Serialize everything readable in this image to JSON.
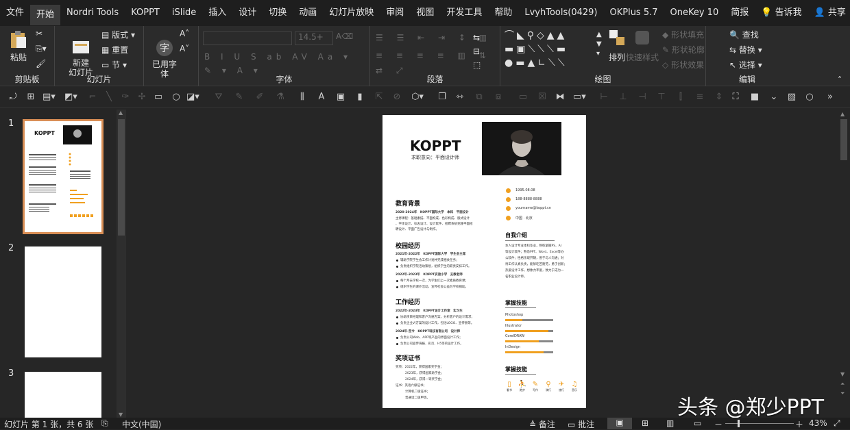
{
  "menu": {
    "tabs": [
      "文件",
      "开始",
      "Nordri Tools",
      "KOPPT",
      "iSlide",
      "插入",
      "设计",
      "切换",
      "动画",
      "幻灯片放映",
      "审阅",
      "视图",
      "开发工具",
      "帮助",
      "LvyhTools(0429)",
      "OKPlus 5.7",
      "OneKey 10",
      "简报"
    ],
    "active": "开始",
    "tell_me": "告诉我",
    "share": "共享"
  },
  "ribbon": {
    "clipboard": {
      "label": "剪贴板",
      "paste": "粘贴"
    },
    "slides": {
      "label": "幻灯片",
      "new_slide": "新建\n幻灯片",
      "layout": "版式",
      "reset": "重置",
      "section": "节"
    },
    "font": {
      "label": "字体",
      "use_font": "已用字\n体",
      "size": "14.5+"
    },
    "paragraph": {
      "label": "段落"
    },
    "drawing": {
      "label": "绘图",
      "arrange": "排列",
      "quick_styles": "快速样式",
      "fill": "形状填充",
      "outline": "形状轮廓",
      "effect": "形状效果"
    },
    "editing": {
      "label": "编辑",
      "find": "查找",
      "replace": "替换",
      "select": "选择"
    }
  },
  "thumbs": {
    "nums": [
      "1",
      "2",
      "3"
    ]
  },
  "slide": {
    "name": "KOPPT",
    "subtitle": "求职意向：平面设计师",
    "contact": [
      "1995.08.08",
      "188-8888-8888",
      "yourname@koppt.cn",
      "中国 · 北京"
    ],
    "edu": {
      "title": "教育背景",
      "line1": "2020-2024年　KOPPT国际大学　本科　平面设计",
      "line2": "主修课程：基础素描、平面构成、色彩构成、版式设计",
      "line3": "、字体设计、标志设计、设计软件、招聘系统克隆平面招",
      "line4": "聘设计、平面广告设计与制作。"
    },
    "campus": {
      "title": "校园经历",
      "h1": "2021年-2022年　KOPPT国际大学　学生会主席",
      "b1": "辅助学院学生会工作计划并完成相关任务；",
      "b2": "负责组织学院活动策划，组织学生的职责安排工作。",
      "h2": "2022年-2023年　KOPPT实验小学　支教老师",
      "b3": "每个月去学校一次，为学生们上一次素质教育课；",
      "b4": "组织学生的课外活动，宣传社会公益为学校捐助。"
    },
    "work": {
      "title": "工作经历",
      "h1": "2022年-2023年　KOPPT设计工作室　实习生",
      "b1": "协助项目经理和客户沟通方案，分析客户的设计需求；",
      "b2": "负责企业VI方案的设计工作，包括LOGO、宣传册等。",
      "h2": "2024年-至今　KOPPT科技有限公司　设计师",
      "b3": "负责公司Web、APP等产品的界面设计工作；",
      "b4": "负责公司宣传海报、彩页、H5等的设计工作。"
    },
    "awards": {
      "title": "奖项证书",
      "l1": "奖项：2022年，获得国家奖学金；",
      "l2": "2023年，获得国家助学金；",
      "l3": "2024年，获得一等奖学金；",
      "l4": "证书：英语六级证书；",
      "l5": "计算机二级证书；",
      "l6": "普通话二级甲等。"
    },
    "about": {
      "title": "自我介绍",
      "lines": [
        "本人设计专业本科毕业，熟练掌握PS、AI",
        "等设计软件；熟悉PPT、Word、Excel等办",
        "公软件；性格乐观开朗，善于与人沟通；对",
        "待工作认真负责，能够吃苦耐劳，勇于创新；",
        "热爱设计工作，想象力丰富，致力于成为一",
        "名职业设计师。"
      ]
    },
    "skills": {
      "title": "掌握技能",
      "items": [
        {
          "name": "Photoshop",
          "level": 0.35
        },
        {
          "name": "Illustrator",
          "level": 0.9
        },
        {
          "name": "CorelDRAW",
          "level": 0.7
        },
        {
          "name": "InDesign",
          "level": 0.8
        }
      ]
    },
    "hobbies": {
      "title": "掌握技能",
      "items": [
        "看书",
        "跑步",
        "写作",
        "骑行",
        "旅行",
        "音乐"
      ]
    }
  },
  "status": {
    "slide_info": "幻灯片 第 1 张，共 6 张",
    "lang": "中文(中国)",
    "notes": "备注",
    "comments": "批注",
    "zoom": "43%"
  },
  "watermark": "头条 @郑少PPT",
  "colors": {
    "accent": "#f0a020",
    "thumb_border": "#d98e55",
    "bg": "#262626"
  }
}
